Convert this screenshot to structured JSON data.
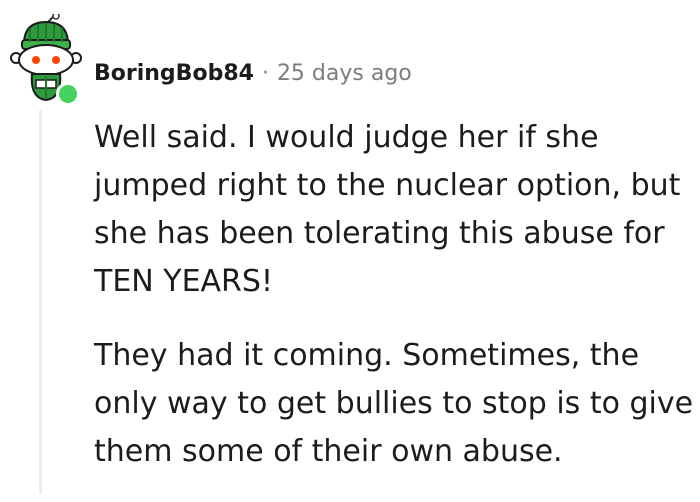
{
  "comment": {
    "author": "BoringBob84",
    "separator": "·",
    "timestamp": "25 days ago",
    "online_status_color": "#46d160",
    "paragraphs": [
      "Well said. I would judge her if she\njumped right to the nuclear option, but\nshe has been tolerating this abuse for\nTEN YEARS!",
      "They had it coming. Sometimes, the\nonly way to get bullies to stop is to give\nthem some of their own abuse."
    ]
  },
  "colors": {
    "text": "#1c1c1c",
    "meta": "#7c7c7c",
    "thread_line": "#ededed",
    "avatar_hat": "#2e9a3e"
  }
}
